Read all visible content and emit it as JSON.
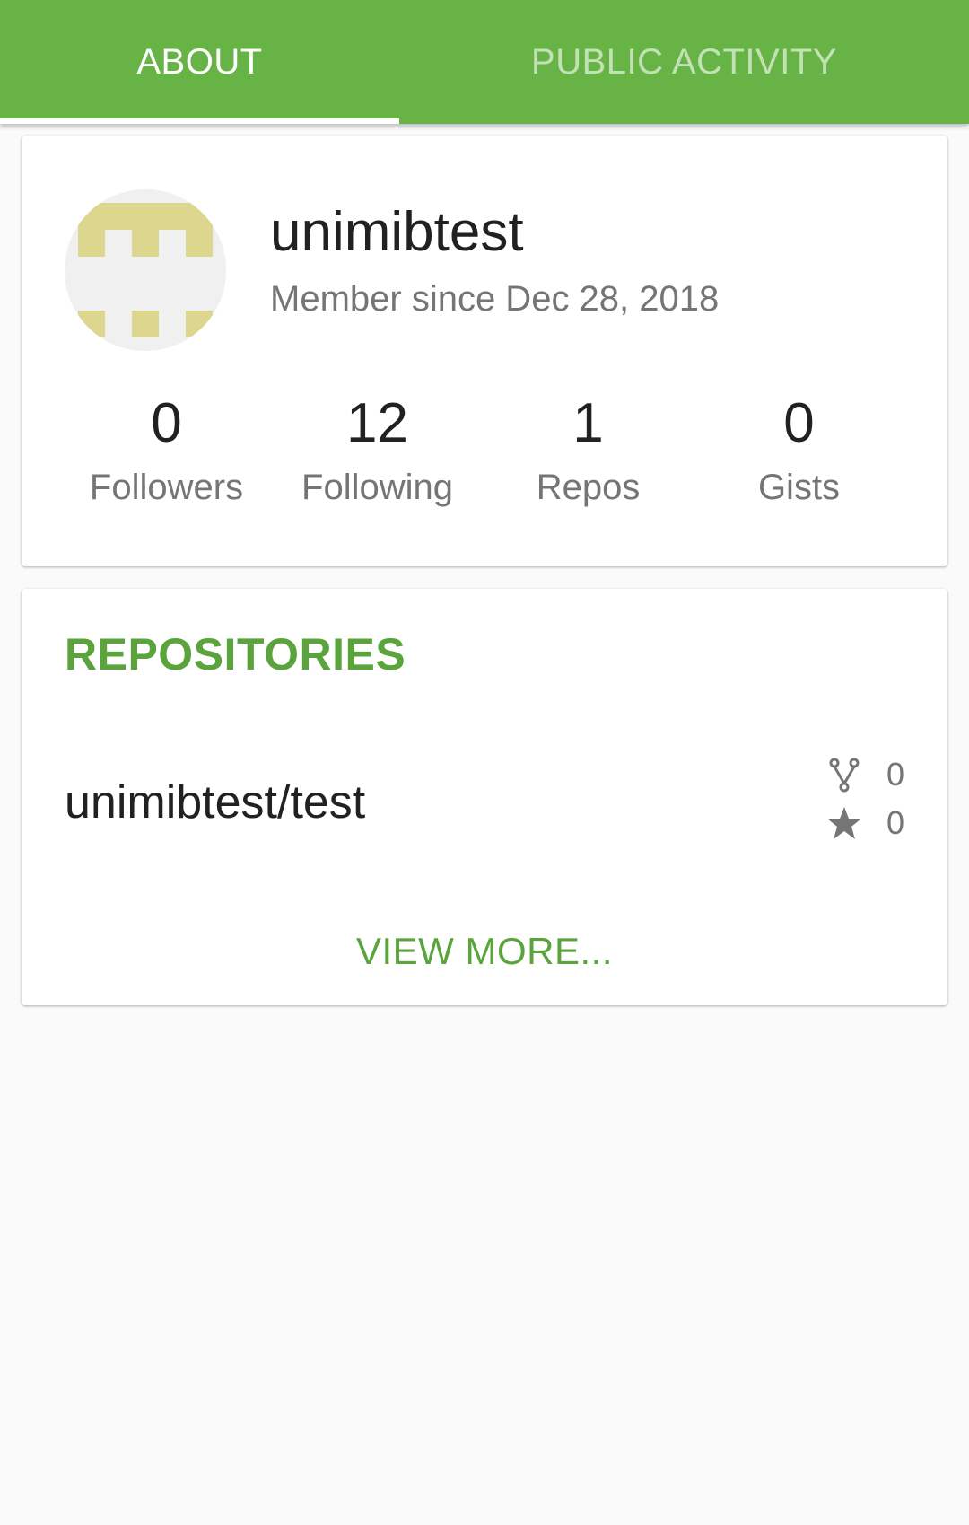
{
  "tabs": [
    {
      "label": "ABOUT",
      "selected": true
    },
    {
      "label": "PUBLIC ACTIVITY",
      "selected": false
    }
  ],
  "profile": {
    "username": "unimibtest",
    "member_since": "Member since Dec 28, 2018",
    "stats": [
      {
        "count": "0",
        "label": "Followers"
      },
      {
        "count": "12",
        "label": "Following"
      },
      {
        "count": "1",
        "label": "Repos"
      },
      {
        "count": "0",
        "label": "Gists"
      }
    ]
  },
  "repositories": {
    "title": "REPOSITORIES",
    "items": [
      {
        "name": "unimibtest/test",
        "forks": "0",
        "stars": "0"
      }
    ],
    "view_more": "VIEW MORE..."
  },
  "colors": {
    "primary": "#67b346",
    "accent_text": "#5ba33c",
    "avatar_pattern": "#dcd68e",
    "avatar_bg": "#f0f0f0"
  },
  "icons": {
    "fork": "fork-icon",
    "star": "star-icon"
  }
}
